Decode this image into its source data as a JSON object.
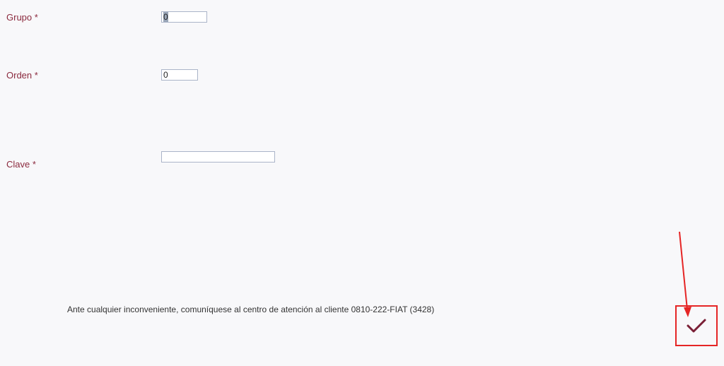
{
  "form": {
    "grupo": {
      "label": "Grupo *",
      "value": "0"
    },
    "orden": {
      "label": "Orden *",
      "value": "0"
    },
    "clave": {
      "label": "Clave *",
      "value": ""
    }
  },
  "footer": {
    "contact_text": "Ante cualquier inconveniente, comuníquese al centro de atención al cliente 0810-222-FIAT (3428)"
  },
  "icons": {
    "confirm": "checkmark-icon"
  },
  "colors": {
    "label": "#8b2a3e",
    "checkmark": "#7a1f36",
    "annotation": "#e52525",
    "background": "#f8f8fa"
  }
}
